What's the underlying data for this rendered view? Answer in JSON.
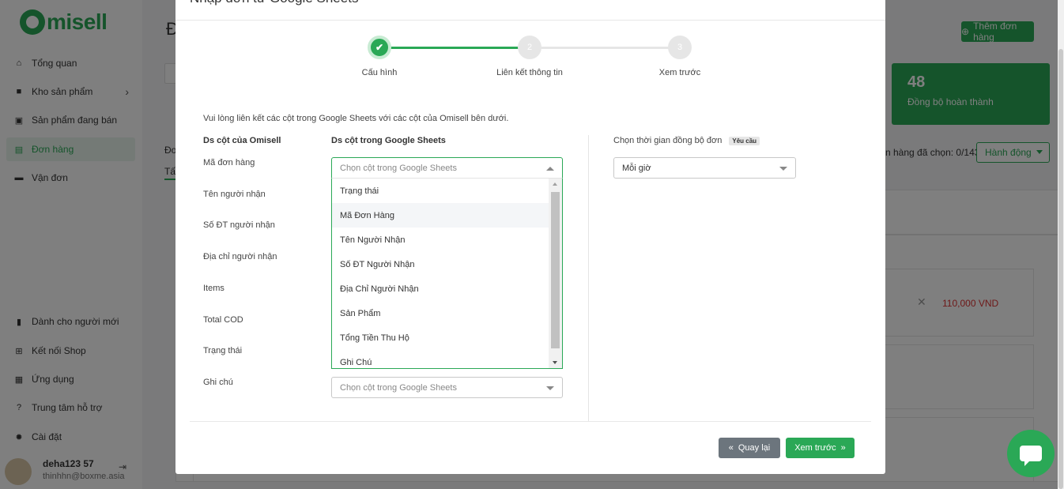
{
  "app": {
    "logo_text": "misell",
    "page_title": "Đ",
    "add_order_button": "Thêm đơn hàng",
    "stat": {
      "value": "48",
      "label": "Đồng bộ hoàn thành"
    },
    "selected_text": "n hàng đã chọn: 0/143",
    "action_button": "Hành động",
    "tab_label": "Tấ",
    "row_label": "Đơ",
    "order_price": "110,000 VND",
    "colors": {
      "brand": "#2aa856",
      "danger": "#dd3333"
    }
  },
  "sidebar": {
    "items": [
      {
        "label": "Tổng quan",
        "icon": "home-icon"
      },
      {
        "label": "Kho sản phẩm",
        "icon": "box-icon"
      },
      {
        "label": "Sản phẩm đang bán",
        "icon": "bag-icon"
      },
      {
        "label": "Đơn hàng",
        "icon": "orders-icon"
      },
      {
        "label": "Vận đơn",
        "icon": "truck-icon"
      },
      {
        "label": "Dành cho người mới",
        "icon": "book-icon"
      },
      {
        "label": "Kết nối Shop",
        "icon": "cart-icon"
      },
      {
        "label": "Ứng dụng",
        "icon": "apps-icon"
      },
      {
        "label": "Trung tâm hỗ trợ",
        "icon": "help-icon"
      },
      {
        "label": "Cài đặt",
        "icon": "gear-icon"
      }
    ],
    "user": {
      "name": "deha123 57",
      "email": "thinhhn@boxme.asia"
    }
  },
  "modal": {
    "title": "Nhập đơn từ Google Sheets",
    "steps": [
      {
        "number": "✔",
        "label": "Cấu hình"
      },
      {
        "number": "2",
        "label": "Liên kết thông tin"
      },
      {
        "number": "3",
        "label": "Xem trước"
      }
    ],
    "instruction": "Vui lòng liên kết các cột trong Google Sheets với các cột của Omisell bên dưới.",
    "col_omisell": "Ds cột của Omisell",
    "col_sheets": "Ds cột trong Google Sheets",
    "fields": [
      "Mã đơn hàng",
      "Tên người nhận",
      "Số ĐT người nhận",
      "Địa chỉ người nhận",
      "Items",
      "Total COD",
      "Trạng thái",
      "Ghi chú"
    ],
    "select_placeholder": "Chọn cột trong Google Sheets",
    "dropdown_options": [
      "Trạng thái",
      "Mã Đơn Hàng",
      "Tên Người Nhận",
      "Số ĐT Người Nhận",
      "Địa Chỉ Người Nhận",
      "Sản Phẩm",
      "Tổng Tiền Thu Hộ",
      "Ghi Chú"
    ],
    "sync_label": "Chọn thời gian đồng bộ đơn",
    "required_badge": "Yêu cầu",
    "sync_value": "Mỗi giờ",
    "back_button": "Quay lại",
    "next_button": "Xem trước"
  }
}
